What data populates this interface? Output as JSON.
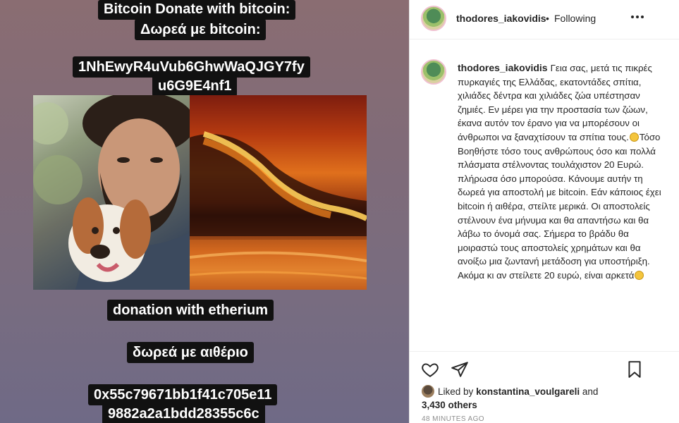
{
  "story": {
    "line1": "Bitcoin Donate with bitcoin:",
    "line2": "Δωρεά με bitcoin:",
    "btc_address_1": "1NhEwyR4uVub6GhwWaQJGY7fy",
    "btc_address_2": "u6G9E4nf1",
    "eth_label_en": "donation with etherium",
    "eth_label_gr": "δωρεά με αιθέριο",
    "eth_address_1": "0x55c79671bb1f41c705e11",
    "eth_address_2": "9882a2a1bdd28355c6c"
  },
  "post": {
    "header": {
      "username": "thodores_iakovidis",
      "separator": "•",
      "follow_status": "Following",
      "more_icon": "more-horizontal-icon"
    },
    "caption": {
      "username": "thodores_iakovidis",
      "text_part1": "Γεια σας, μετά τις πικρές πυρκαγιές της Ελλάδας, εκατοντάδες σπίτια, χιλιάδες δέντρα και χιλιάδες ζώα υπέστησαν ζημιές. Εν μέρει για την προστασία των ζώων, έκανα αυτόν τον έρανο για να μπορέσουν οι άνθρωποι να ξαναχτίσουν τα σπίτια τους.",
      "text_part2": "Τόσο Βοηθήστε τόσο τους ανθρώπους όσο και πολλά πλάσματα στέλνοντας τουλάχιστον 20 Ευρώ. πλήρωσα όσο μπορούσα. Κάνουμε αυτήν τη δωρεά για αποστολή με bitcoin. Εάν κάποιος έχει bitcoin ή αιθέρα, στείλτε μερικά. Οι αποστολείς στέλνουν ένα μήνυμα και θα απαντήσω και θα λάβω το όνομά σας. Σήμερα το βράδυ θα μοιραστώ τους αποστολείς χρημάτων και θα ανοίξω μια ζωντανή μετάδοση για υποστήριξη. Ακόμα κι αν στείλετε 20 ευρώ, είναι αρκετά"
    },
    "actions": {
      "like_icon": "heart-icon",
      "share_icon": "paper-plane-icon",
      "save_icon": "bookmark-icon"
    },
    "likes": {
      "prefix": "Liked by",
      "user": "konstantina_voulgareli",
      "and": "and",
      "others": "3,430 others"
    },
    "timestamp": "48 MINUTES AGO"
  }
}
